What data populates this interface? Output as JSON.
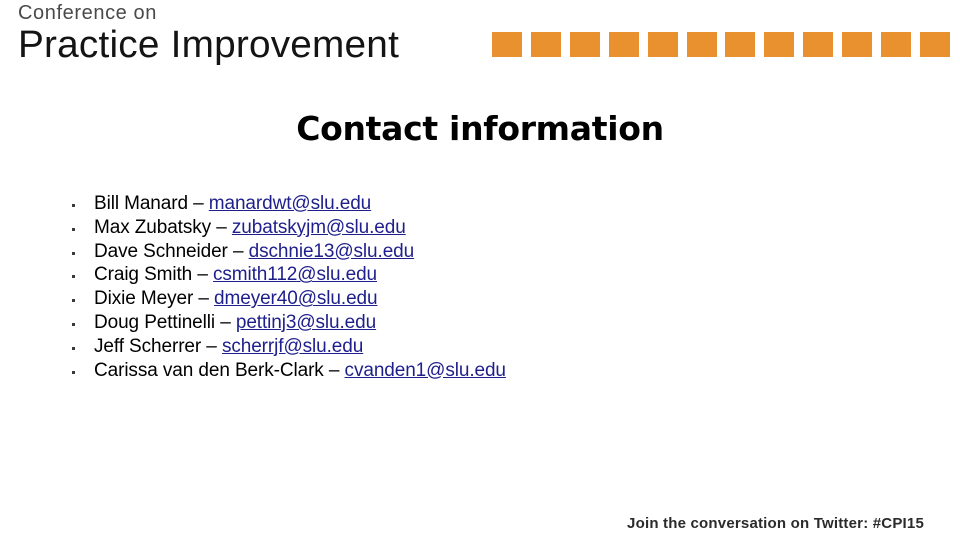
{
  "slide": {
    "background_color": "#ffffff",
    "title": "Contact information"
  },
  "header": {
    "logo_line_1": "Conference on",
    "logo_line_2": "Practice Improvement",
    "accent_color": "#E8912E",
    "decoration": {
      "shape": "square",
      "count": 12,
      "color": "#E8912E"
    }
  },
  "contacts": {
    "bullet_glyph": "square-bullet",
    "email_color": "#1F1F8C",
    "items": [
      {
        "name": "Bill Manard",
        "separator": "–",
        "email": "manardwt@slu.edu"
      },
      {
        "name": "Max Zubatsky",
        "separator": "–",
        "email": "zubatskyjm@slu.edu"
      },
      {
        "name": "Dave Schneider",
        "separator": "–",
        "email": "dschnie13@slu.edu"
      },
      {
        "name": "Craig Smith",
        "separator": "–",
        "email": "csmith112@slu.edu"
      },
      {
        "name": "Dixie Meyer",
        "separator": "–",
        "email": "dmeyer40@slu.edu"
      },
      {
        "name": "Doug Pettinelli",
        "separator": "–",
        "email": "pettinj3@slu.edu"
      },
      {
        "name": "Jeff Scherrer",
        "separator": "–",
        "email": "scherrjf@slu.edu"
      },
      {
        "name": "Carissa van den Berk-Clark",
        "separator": "–",
        "email": "cvanden1@slu.edu"
      }
    ]
  },
  "footer": {
    "note": "Join the conversation on Twitter: #CPI15"
  }
}
